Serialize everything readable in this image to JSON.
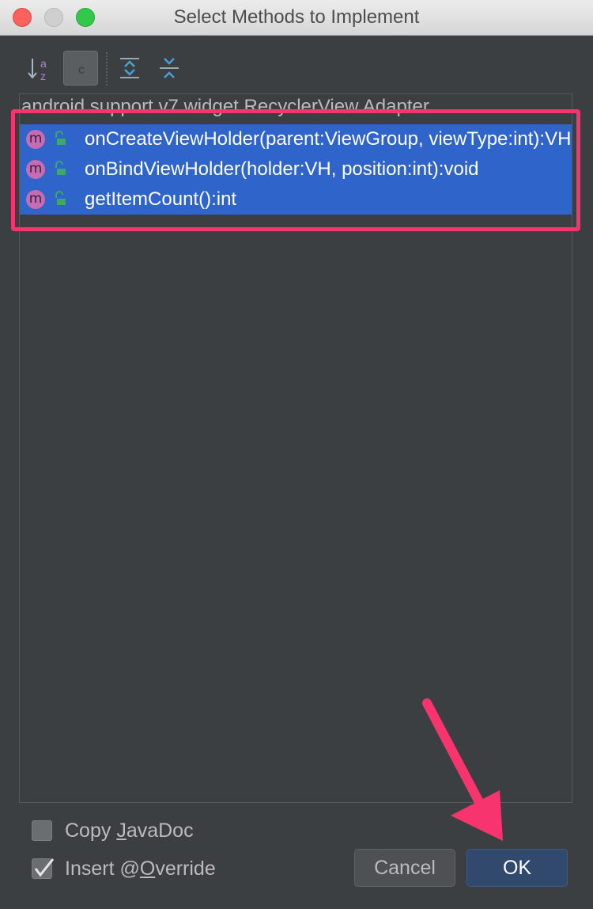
{
  "window": {
    "title": "Select Methods to Implement"
  },
  "toolbar": {
    "class_toggle_label": "c",
    "icons": [
      "sort-alpha-icon",
      "show-classes-icon",
      "expand-all-icon",
      "collapse-all-icon"
    ]
  },
  "tree": {
    "group": "android.support.v7.widget.RecyclerView.Adapter",
    "methods": [
      {
        "badge": "m",
        "label": "onCreateViewHolder(parent:ViewGroup, viewType:int):VH"
      },
      {
        "badge": "m",
        "label": "onBindViewHolder(holder:VH, position:int):void"
      },
      {
        "badge": "m",
        "label": "getItemCount():int"
      }
    ]
  },
  "options": {
    "copy_javadoc": {
      "label_pre": "Copy ",
      "label_mnemonic": "J",
      "label_post": "avaDoc",
      "checked": false
    },
    "insert_override": {
      "label_pre": "Insert @",
      "label_mnemonic": "O",
      "label_post": "verride",
      "checked": true
    }
  },
  "buttons": {
    "cancel": "Cancel",
    "ok": "OK"
  },
  "colors": {
    "selection": "#2f65ca",
    "highlight_box": "#f8346e",
    "arrow": "#f8346e",
    "method_badge": "#c66cb3",
    "lock": "#3fa66f"
  }
}
